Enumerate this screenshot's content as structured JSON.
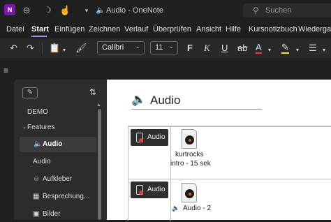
{
  "window": {
    "title": "Audio  -  OneNote",
    "app_logo": "N",
    "search_placeholder": "Suchen"
  },
  "menu": {
    "items": [
      "Datei",
      "Start",
      "Einfügen",
      "Zeichnen",
      "Verlauf",
      "Überprüfen",
      "Ansicht",
      "Hilfe",
      "Kursnotizbuch",
      "Wiedergabe"
    ],
    "active": "Start"
  },
  "ribbon": {
    "font_name": "Calibri",
    "font_size": "11",
    "bold": "F",
    "italic": "K",
    "underline": "U",
    "strike": "ab",
    "font_color_letter": "A"
  },
  "sidebar": {
    "items": [
      {
        "label": "DEMO"
      },
      {
        "label": "Features"
      },
      {
        "label": "Audio"
      },
      {
        "label": "Audio"
      },
      {
        "label": "Aufkleber"
      },
      {
        "label": "Besprechung..."
      },
      {
        "label": "Bilder"
      }
    ]
  },
  "page": {
    "title": "Audio",
    "rows": [
      {
        "button_label": "Audio",
        "file_caption_line1": "kurtrocks",
        "file_caption_line2": "intro - 15 sek"
      },
      {
        "button_label": "Audio",
        "file_caption": "Audio - 2"
      }
    ]
  },
  "colors": {
    "accent": "#b38be8",
    "app_purple": "#7719aa",
    "record_red": "#e23b3b"
  }
}
